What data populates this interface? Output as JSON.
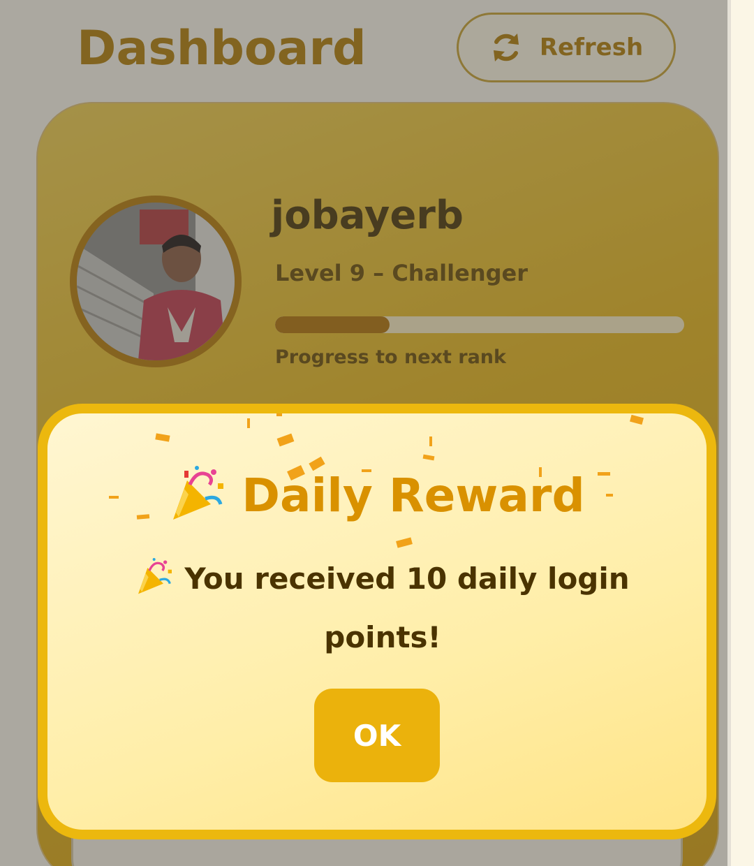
{
  "header": {
    "title": "Dashboard",
    "refresh_label": "Refresh"
  },
  "profile": {
    "username": "jobayerb",
    "level_text": "Level 9 – Challenger",
    "progress_fraction": 0.28,
    "progress_caption": "Progress to next rank"
  },
  "modal": {
    "title": "Daily Reward",
    "title_icon": "party-popper-icon",
    "message": "You received 10 daily login points!",
    "message_icon": "party-popper-icon",
    "ok_label": "OK"
  },
  "colors": {
    "accent": "#d99100",
    "brand": "#ecb80e",
    "dark_text": "#4a3300",
    "progress_fill": "#b27200"
  }
}
